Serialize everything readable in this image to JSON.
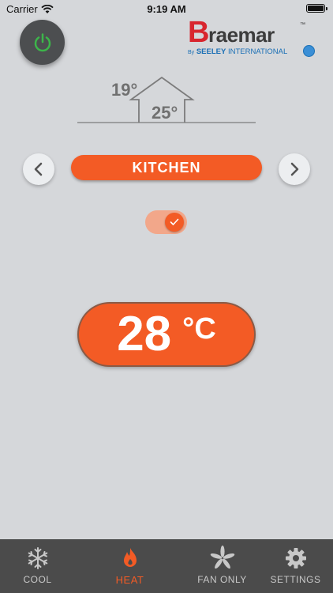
{
  "status_bar": {
    "carrier": "Carrier",
    "time": "9:19 AM"
  },
  "brand": {
    "initial": "B",
    "name": "raemar",
    "trademark": "™",
    "by": "By",
    "company": "SEELEY",
    "company_suffix": " INTERNATIONAL"
  },
  "temperatures": {
    "outdoor": "19°",
    "indoor": "25°"
  },
  "zone": {
    "name": "KITCHEN",
    "enabled": true
  },
  "setpoint": {
    "value": "28",
    "unit": "°C"
  },
  "tabs": [
    {
      "label": "COOL",
      "active": false
    },
    {
      "label": "HEAT",
      "active": true
    },
    {
      "label": "FAN ONLY",
      "active": false
    },
    {
      "label": "SETTINGS",
      "active": false
    }
  ],
  "colors": {
    "accent": "#f35b25",
    "power_on": "#3cb54a",
    "background": "#d5d7da",
    "nav_bg": "#4b4b4b"
  },
  "icons": {
    "power": "power-icon",
    "prev": "chevron-left-icon",
    "next": "chevron-right-icon",
    "toggle_check": "check-icon",
    "cool": "snowflake-icon",
    "heat": "flame-icon",
    "fan": "fan-icon",
    "settings": "gear-icon"
  }
}
